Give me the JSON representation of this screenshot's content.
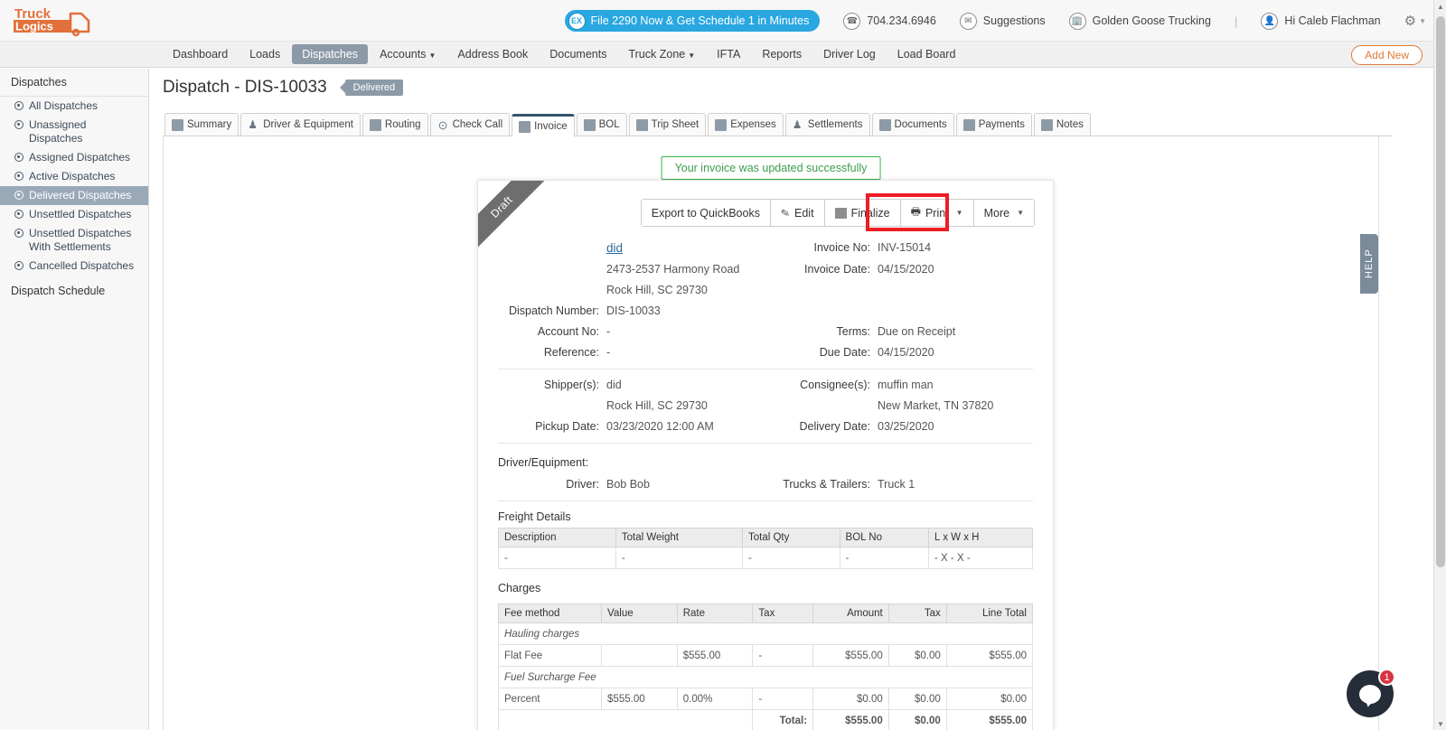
{
  "header": {
    "logo_alt": "TruckLogics",
    "promo": {
      "badge": "EX",
      "text": "File 2290 Now & Get Schedule 1 in Minutes"
    },
    "phone": "704.234.6946",
    "suggestions": "Suggestions",
    "company": "Golden Goose Trucking",
    "separator": "|",
    "user_greeting": "Hi Caleb Flachman"
  },
  "nav": {
    "items": [
      {
        "label": "Dashboard",
        "active": false,
        "caret": false
      },
      {
        "label": "Loads",
        "active": false,
        "caret": false
      },
      {
        "label": "Dispatches",
        "active": true,
        "caret": false
      },
      {
        "label": "Accounts",
        "active": false,
        "caret": true
      },
      {
        "label": "Address Book",
        "active": false,
        "caret": false
      },
      {
        "label": "Documents",
        "active": false,
        "caret": false
      },
      {
        "label": "Truck Zone",
        "active": false,
        "caret": true
      },
      {
        "label": "IFTA",
        "active": false,
        "caret": false
      },
      {
        "label": "Reports",
        "active": false,
        "caret": false
      },
      {
        "label": "Driver Log",
        "active": false,
        "caret": false
      },
      {
        "label": "Load Board",
        "active": false,
        "caret": false
      }
    ],
    "add_new": "Add New"
  },
  "sidebar": {
    "heading": "Dispatches",
    "items": [
      {
        "label": "All Dispatches",
        "selected": false
      },
      {
        "label": "Unassigned Dispatches",
        "selected": false
      },
      {
        "label": "Assigned Dispatches",
        "selected": false
      },
      {
        "label": "Active Dispatches",
        "selected": false
      },
      {
        "label": "Delivered Dispatches",
        "selected": true
      },
      {
        "label": "Unsettled Dispatches",
        "selected": false
      },
      {
        "label": "Unsettled Dispatches With Settlements",
        "selected": false
      },
      {
        "label": "Cancelled Dispatches",
        "selected": false
      }
    ],
    "sub_heading": "Dispatch Schedule"
  },
  "page": {
    "title": "Dispatch - DIS-10033",
    "status_badge": "Delivered"
  },
  "tabs": [
    {
      "label": "Summary",
      "icon": "truck-icon",
      "active": false
    },
    {
      "label": "Driver & Equipment",
      "icon": "person-gear-icon",
      "active": false
    },
    {
      "label": "Routing",
      "icon": "route-icon",
      "active": false
    },
    {
      "label": "Check Call",
      "icon": "map-pin-icon",
      "active": false
    },
    {
      "label": "Invoice",
      "icon": "invoice-icon",
      "active": true
    },
    {
      "label": "BOL",
      "icon": "bol-icon",
      "active": false
    },
    {
      "label": "Trip Sheet",
      "icon": "trip-sheet-icon",
      "active": false
    },
    {
      "label": "Expenses",
      "icon": "expenses-icon",
      "active": false
    },
    {
      "label": "Settlements",
      "icon": "settlements-icon",
      "active": false
    },
    {
      "label": "Documents",
      "icon": "documents-icon",
      "active": false
    },
    {
      "label": "Payments",
      "icon": "payments-icon",
      "active": false
    },
    {
      "label": "Notes",
      "icon": "notes-icon",
      "active": false
    }
  ],
  "alert": {
    "message": "Your invoice was updated successfully",
    "color": "#3eb34f"
  },
  "invoice": {
    "ribbon": "Draft",
    "actions": {
      "export": "Export to QuickBooks",
      "edit": "Edit",
      "finalize": "Finalize",
      "print": "Print",
      "more": "More"
    },
    "highlight_color": "#ee1c24",
    "customer": {
      "name": "did",
      "address_line1": "2473-2537 Harmony Road",
      "address_line2": "Rock Hill, SC 29730"
    },
    "fields": {
      "invoice_no_label": "Invoice No:",
      "invoice_no": "INV-15014",
      "invoice_date_label": "Invoice Date:",
      "invoice_date": "04/15/2020",
      "dispatch_number_label": "Dispatch Number:",
      "dispatch_number": "DIS-10033",
      "account_no_label": "Account No:",
      "account_no": "-",
      "reference_label": "Reference:",
      "reference": "-",
      "terms_label": "Terms:",
      "terms": "Due on Receipt",
      "due_date_label": "Due Date:",
      "due_date": "04/15/2020",
      "shipper_label": "Shipper(s):",
      "shipper_name": "did",
      "shipper_city": "Rock Hill, SC 29730",
      "pickup_date_label": "Pickup Date:",
      "pickup_date": "03/23/2020 12:00 AM",
      "consignee_label": "Consignee(s):",
      "consignee_name": "muffin man",
      "consignee_city": "New Market, TN 37820",
      "delivery_date_label": "Delivery Date:",
      "delivery_date": "03/25/2020"
    },
    "driver_equipment": {
      "section_title": "Driver/Equipment:",
      "driver_label": "Driver:",
      "driver": "Bob Bob",
      "trucks_label": "Trucks & Trailers:",
      "trucks": "Truck 1"
    },
    "freight_details": {
      "title": "Freight Details",
      "columns": [
        "Description",
        "Total Weight",
        "Total Qty",
        "BOL No",
        "L x W x H"
      ],
      "rows": [
        [
          "-",
          "-",
          "-",
          "-",
          "- X - X -"
        ]
      ]
    },
    "charges": {
      "title": "Charges",
      "columns": [
        "Fee method",
        "Value",
        "Rate",
        "Tax",
        "Amount",
        "Tax",
        "Line Total"
      ],
      "groups": [
        {
          "group_label": "Hauling charges",
          "method": "Flat Fee",
          "value": "",
          "rate": "$555.00",
          "tax1": "-",
          "amount": "$555.00",
          "tax2": "$0.00",
          "line_total": "$555.00"
        },
        {
          "group_label": "Fuel Surcharge Fee",
          "method": "Percent",
          "value": "$555.00",
          "rate": "0.00%",
          "tax1": "-",
          "amount": "$0.00",
          "tax2": "$0.00",
          "line_total": "$0.00"
        }
      ],
      "total_label": "Total:",
      "total_amount": "$555.00",
      "total_tax": "$0.00",
      "total_line": "$555.00"
    }
  },
  "help_tab": {
    "label": "HELP"
  },
  "chat": {
    "badge_count": "1",
    "icon": "chat-bubble-icon"
  }
}
